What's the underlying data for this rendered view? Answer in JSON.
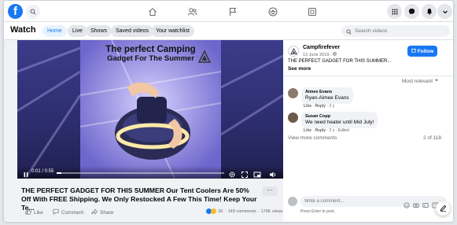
{
  "colors": {
    "brand": "#1877f2",
    "bg": "#f0f2f5",
    "active_tab_bg": "#e7f3ff"
  },
  "nav": {
    "logo": "f",
    "center_icons": [
      "home-icon",
      "friends-icon",
      "flag-icon",
      "groups-icon",
      "gaming-icon"
    ],
    "right_icons": [
      "menu-grid-icon",
      "messenger-icon",
      "notifications-icon",
      "account-icon"
    ]
  },
  "watch": {
    "title": "Watch",
    "tabs": [
      {
        "label": "Home",
        "active": true
      },
      {
        "label": "Live"
      },
      {
        "label": "Shows"
      },
      {
        "label": "Saved videos"
      },
      {
        "label": "Your watchlist"
      }
    ],
    "search_placeholder": "Search videos"
  },
  "video": {
    "overlay_text_line1": "The perfect Camping",
    "overlay_text_line2": "Gadget For The Summer",
    "time": "0:01 / 0:55",
    "progress": 0.03
  },
  "post": {
    "title": "THE PERFECT GADGET FOR THIS SUMMER Our Tent Coolers Are 50% Off With FREE Shipping. We Only Restocked A Few This Time! Keep Your Te...",
    "more": "···",
    "like_label": "Like",
    "comment_label": "Comment",
    "share_label": "Share",
    "reactions": "1K",
    "comments_count": "149 comments",
    "views": "176K views"
  },
  "page": {
    "name": "Campfirefever",
    "date": "13 June 2019 · ",
    "desc": "THE PERFECT GADGET FOR THIS SUMMER...",
    "see_more": "See more",
    "follow_label": "Follow"
  },
  "comments": {
    "sort_label": "Most relevant",
    "items": [
      {
        "name": "Aimee Evans",
        "text": "Ryan-Aimee Evans",
        "like": "Like",
        "reply": "Reply",
        "meta": "2 y"
      },
      {
        "name": "Susan Copp",
        "text": "We need heater until Mid July!",
        "like": "Like",
        "reply": "Reply",
        "meta": "2 y · Edited"
      }
    ],
    "view_more": "View more comments",
    "count": "2 of 118",
    "composer_placeholder": "Write a comment...",
    "press_enter": "Press Enter to post."
  }
}
